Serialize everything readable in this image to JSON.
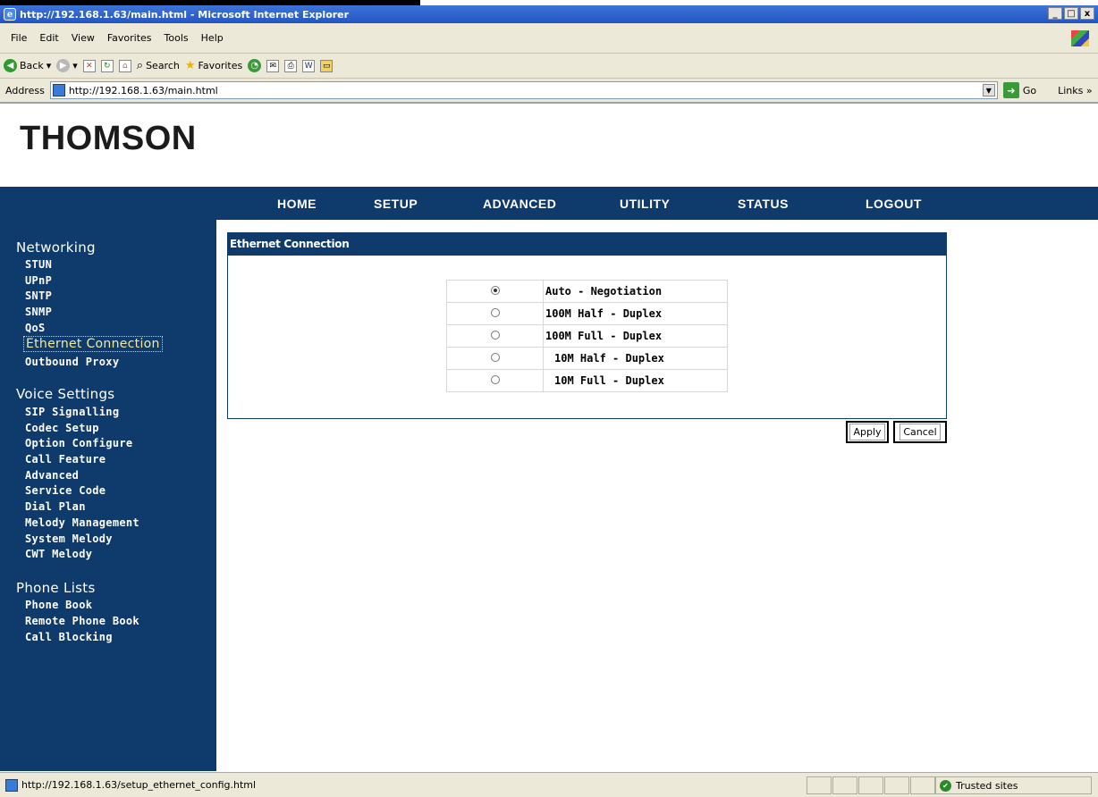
{
  "window": {
    "title": "http://192.168.1.63/main.html - Microsoft Internet Explorer",
    "controls": [
      "_",
      "□",
      "x"
    ]
  },
  "menubar": {
    "items": [
      "File",
      "Edit",
      "View",
      "Favorites",
      "Tools",
      "Help"
    ]
  },
  "toolbar": {
    "back_label": "Back",
    "search_label": "Search",
    "favorites_label": "Favorites"
  },
  "addressbar": {
    "label": "Address",
    "url": "http://192.168.1.63/main.html",
    "go_label": "Go",
    "links_label": "Links"
  },
  "page": {
    "logo": "THOMSON",
    "nav": [
      "HOME",
      "SETUP",
      "ADVANCED",
      "UTILITY",
      "STATUS",
      "LOGOUT"
    ],
    "sidebar": {
      "networking_title": "Networking",
      "networking_items": [
        "STUN",
        "UPnP",
        "SNTP",
        "SNMP",
        "QoS",
        "Ethernet Connection",
        "Outbound Proxy"
      ],
      "voice_title": "Voice Settings",
      "voice_items": [
        "SIP Signalling",
        "Codec Setup",
        "Option Configure",
        "Call Feature",
        "Advanced",
        "Service Code",
        "Dial Plan",
        "Melody Management",
        "System Melody",
        "CWT Melody"
      ],
      "phone_title": "Phone Lists",
      "phone_items": [
        "Phone Book",
        "Remote Phone Book",
        "Call Blocking"
      ]
    },
    "panel": {
      "title": "Ethernet Connection",
      "options": [
        "Auto - Negotiation",
        "100M Half - Duplex",
        "100M Full - Duplex",
        "10M Half - Duplex",
        "10M Full - Duplex"
      ],
      "selected": "Auto - Negotiation"
    },
    "buttons": {
      "apply": "Apply",
      "cancel": "Cancel"
    }
  },
  "statusbar": {
    "url": "http://192.168.1.63/setup_ethernet_config.html",
    "zone": "Trusted sites"
  }
}
